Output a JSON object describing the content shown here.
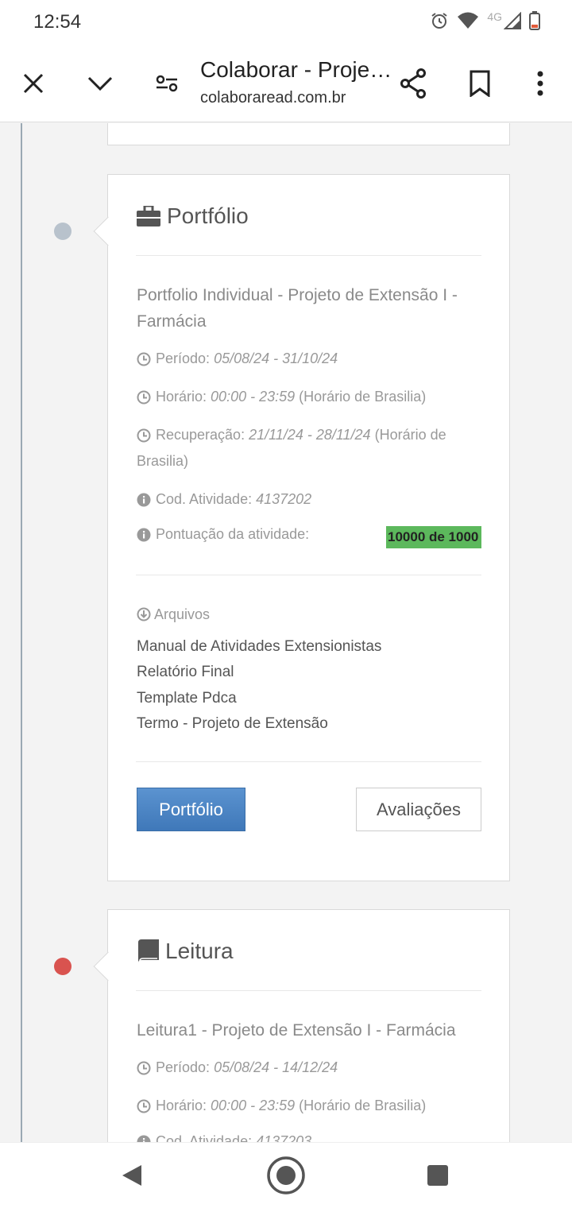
{
  "status_bar": {
    "time": "12:54",
    "network": "4G"
  },
  "browser": {
    "title": "Colaborar - Proje…",
    "url": "colaboraread.com.br",
    "icons": [
      "close-icon",
      "chevron-down-icon",
      "tune-icon",
      "share-icon",
      "bookmark-icon",
      "more-vert-icon"
    ]
  },
  "portfolio_card": {
    "heading": "Portfólio",
    "title": "Portfolio Individual - Projeto de Extensão I - Farmácia",
    "periodo_label": "Período:",
    "periodo_value": "05/08/24 - 31/10/24",
    "horario_label": "Horário:",
    "horario_value": "00:00 - 23:59",
    "horario_suffix": "(Horário de Brasilia)",
    "recuperacao_label": "Recuperação:",
    "recuperacao_value": "21/11/24 - 28/11/24",
    "recuperacao_suffix": "(Horário de Brasilia)",
    "cod_label": "Cod. Atividade:",
    "cod_value": "4137202",
    "pontuacao_label": "Pontuação da atividade:",
    "pontuacao_value": "10000 de 1000",
    "arquivos_label": "Arquivos",
    "files": [
      "Manual de Atividades Extensionistas",
      "Relatório Final",
      "Template Pdca",
      "Termo - Projeto de Extensão"
    ],
    "btn_portfolio": "Portfólio",
    "btn_avaliacoes": "Avaliações",
    "dot_color": "#b8c2cc"
  },
  "leitura_card": {
    "heading": "Leitura",
    "title": "Leitura1 - Projeto de Extensão I - Farmácia",
    "periodo_label": "Período:",
    "periodo_value": "05/08/24 - 14/12/24",
    "horario_label": "Horário:",
    "horario_value": "00:00 - 23:59",
    "horario_suffix": "(Horário de Brasilia)",
    "cod_label": "Cod. Atividade:",
    "cod_value": "4137203",
    "dot_color": "#d9534f"
  }
}
